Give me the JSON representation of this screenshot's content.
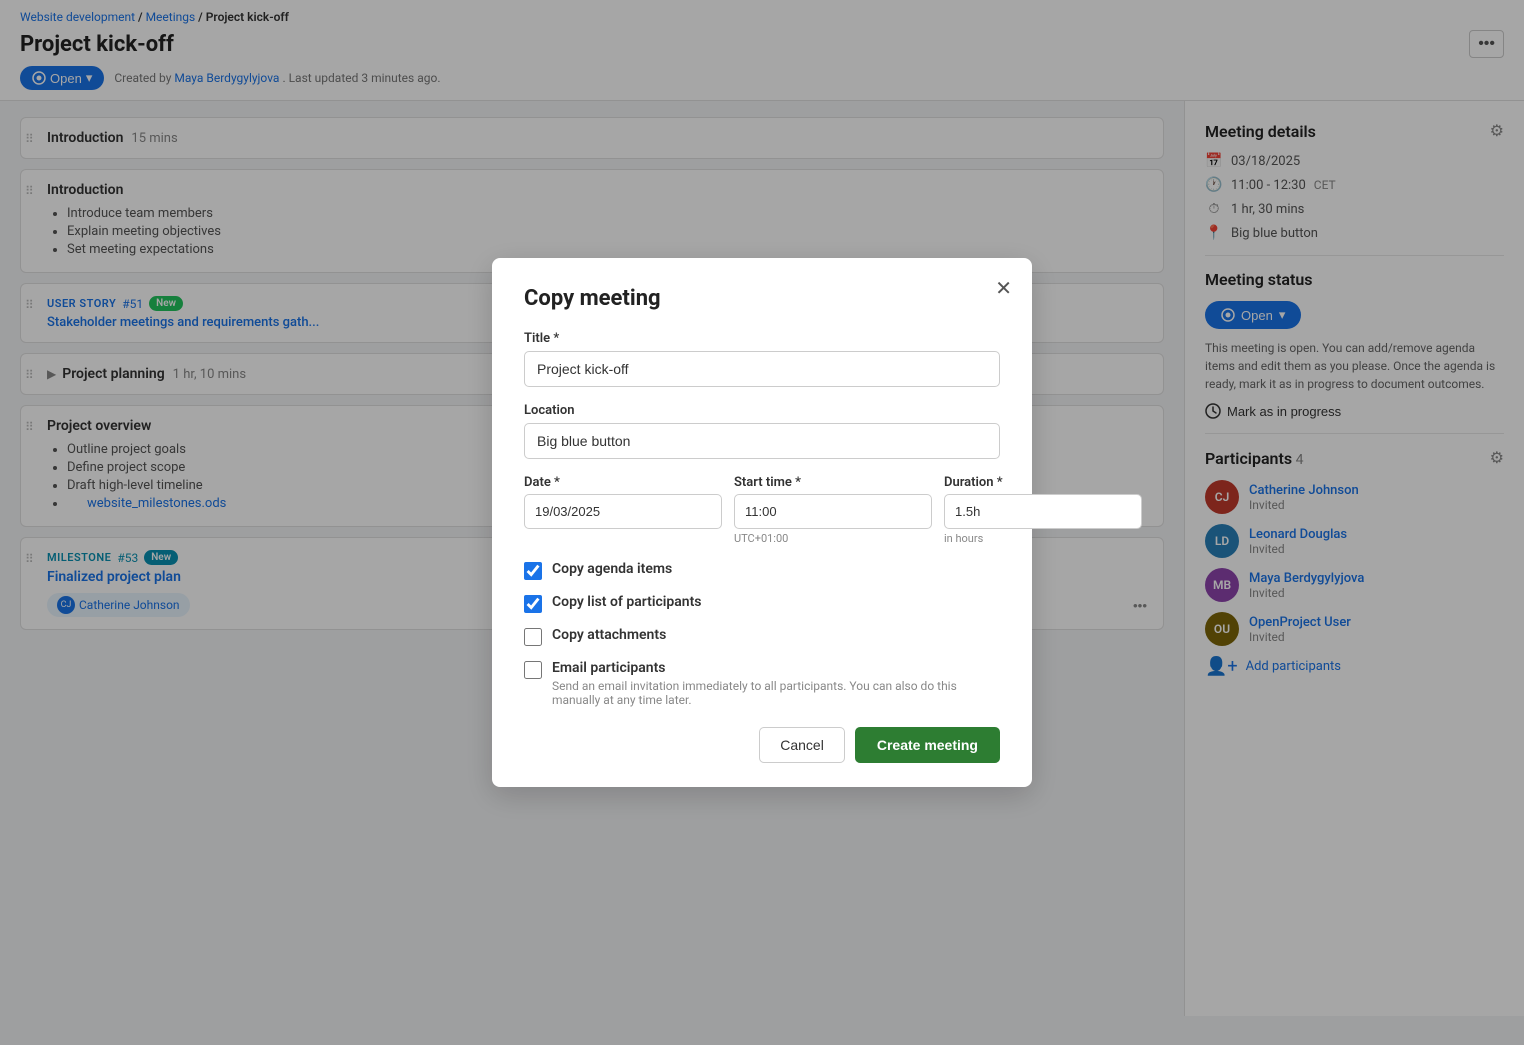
{
  "breadcrumb": {
    "part1": "Website development",
    "separator1": " / ",
    "part2": "Meetings",
    "separator2": " / ",
    "part3": "Project kick-off"
  },
  "page": {
    "title": "Project kick-off",
    "status_label": "Open",
    "created_info": "Created by",
    "created_by": "Maya Berdygylyjova",
    "created_suffix": ". Last updated 3 minutes ago."
  },
  "agenda": [
    {
      "title": "Introduction",
      "duration": "15 mins",
      "type": "section",
      "items": []
    },
    {
      "title": "Introduction",
      "duration": "",
      "type": "detail",
      "items": [
        "Introduce team members",
        "Explain meeting objectives",
        "Set meeting expectations"
      ]
    },
    {
      "title": "USER STORY",
      "number": "#51",
      "badge": "New",
      "type": "user-story",
      "link_text": "Stakeholder meetings and requirements gath..."
    },
    {
      "title": "Project planning",
      "duration": "1 hr, 10 mins",
      "type": "section",
      "items": []
    },
    {
      "title": "Project overview",
      "duration": "",
      "type": "detail",
      "items": [
        "Outline project goals",
        "Define project scope",
        "Draft high-level timeline"
      ],
      "link_item": "website_milestones.ods"
    },
    {
      "title": "MILESTONE",
      "number": "#53",
      "badge": "New",
      "badge_color": "#0891b2",
      "type": "milestone",
      "link_text": "Finalized project plan",
      "participant": "Catherine Johnson"
    }
  ],
  "meeting_details": {
    "section_title": "Meeting details",
    "date": "03/18/2025",
    "time": "11:00 - 12:30",
    "timezone": "CET",
    "duration": "1 hr, 30 mins",
    "location": "Big blue button"
  },
  "meeting_status": {
    "section_title": "Meeting status",
    "status": "Open",
    "description": "This meeting is open. You can add/remove agenda items and edit them as you please. Once the agenda is ready, mark it as in progress to document outcomes.",
    "mark_progress_label": "Mark as in progress"
  },
  "participants": {
    "section_title": "Participants",
    "count": "4",
    "list": [
      {
        "initials": "CJ",
        "name": "Catherine Johnson",
        "status": "Invited",
        "color": "#c0392b"
      },
      {
        "initials": "LD",
        "name": "Leonard Douglas",
        "status": "Invited",
        "color": "#2980b9"
      },
      {
        "initials": "MB",
        "name": "Maya Berdygylyjova",
        "status": "Invited",
        "color": "#8e44ad"
      },
      {
        "initials": "OU",
        "name": "OpenProject User",
        "status": "Invited",
        "color": "#7d6608"
      }
    ],
    "add_label": "Add participants"
  },
  "modal": {
    "title": "Copy meeting",
    "title_label": "Title *",
    "title_value": "Project kick-off",
    "location_label": "Location",
    "location_value": "Big blue button",
    "date_label": "Date *",
    "date_value": "19/03/2025",
    "start_time_label": "Start time *",
    "start_time_value": "11:00",
    "start_time_sub": "UTC+01:00",
    "duration_label": "Duration *",
    "duration_value": "1.5h",
    "duration_sub": "in hours",
    "checkbox_agenda": {
      "label": "Copy agenda items",
      "checked": true
    },
    "checkbox_participants": {
      "label": "Copy list of participants",
      "checked": true
    },
    "checkbox_attachments": {
      "label": "Copy attachments",
      "checked": false
    },
    "checkbox_email": {
      "label": "Email participants",
      "checked": false,
      "description": "Send an email invitation immediately to all participants. You can also do this manually at any time later."
    },
    "cancel_label": "Cancel",
    "create_label": "Create meeting"
  }
}
